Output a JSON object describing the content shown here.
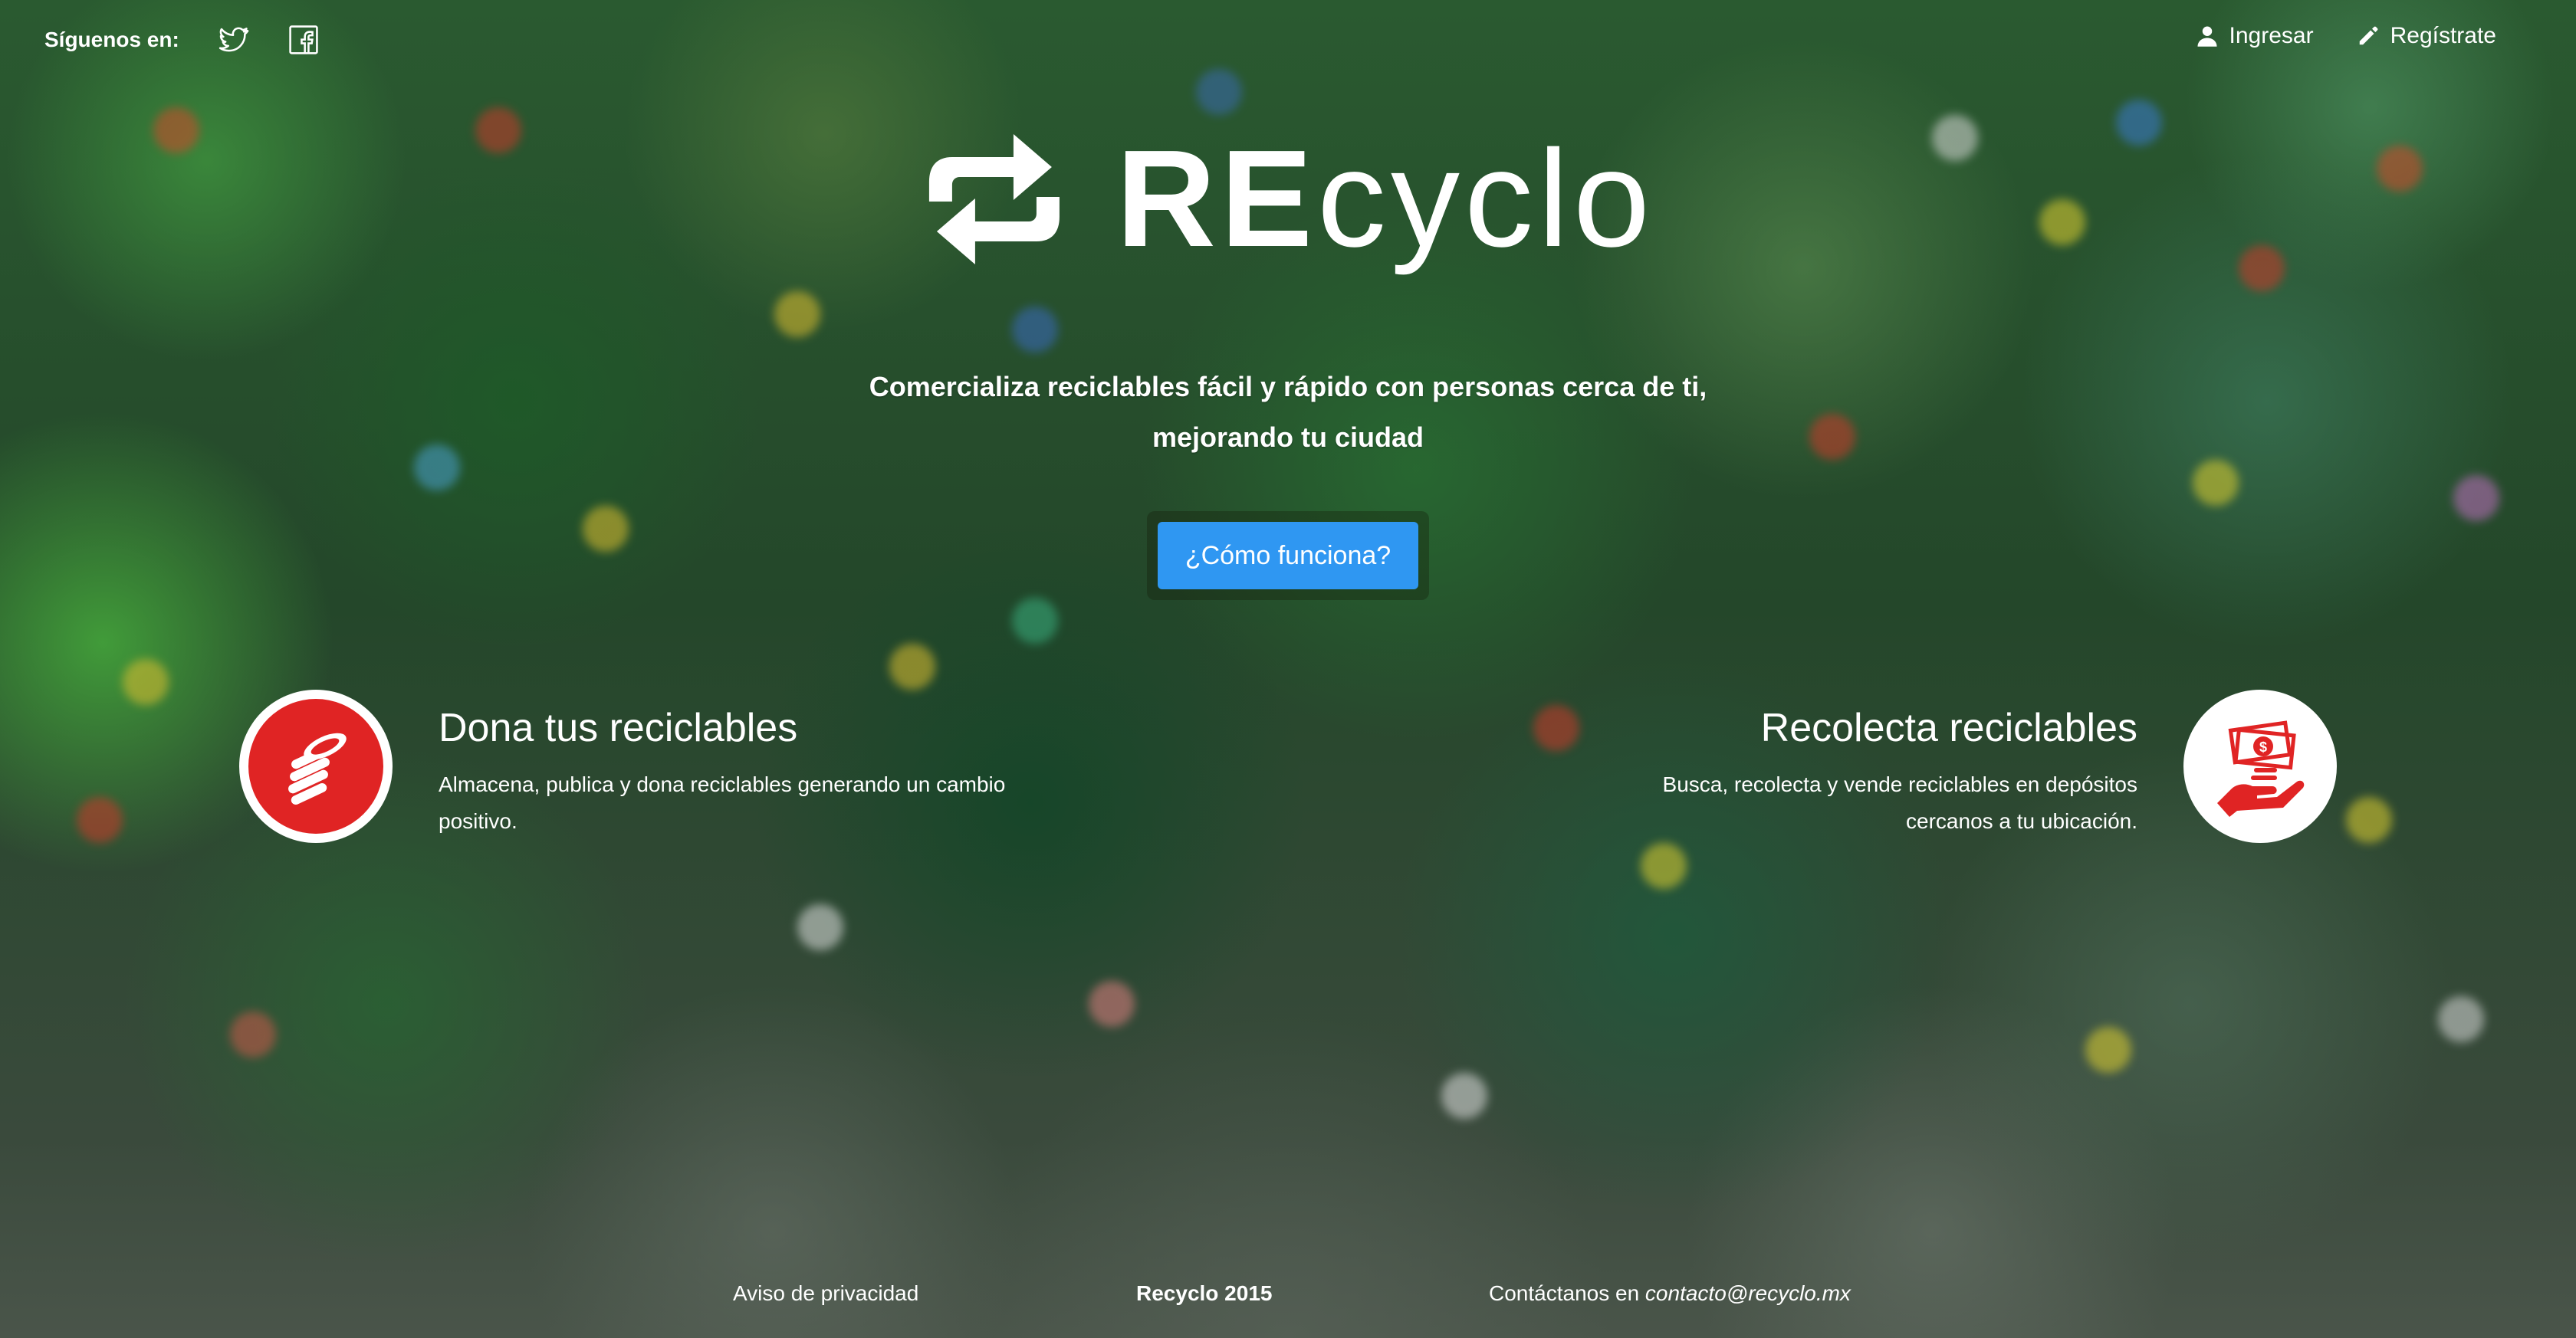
{
  "topbar": {
    "follow_label": "Síguenos en:",
    "social": [
      {
        "icon": "twitter-icon"
      },
      {
        "icon": "facebook-icon"
      }
    ],
    "login_label": "Ingresar",
    "register_label": "Regístrate"
  },
  "logo": {
    "bold": "RE",
    "thin": "cyclo"
  },
  "hero": {
    "tagline": "Comercializa reciclables fácil y rápido con personas cerca de ti, mejorando tu ciudad",
    "cta_label": "¿Cómo funciona?"
  },
  "features": {
    "donate": {
      "title": "Dona tus reciclables",
      "description": "Almacena, publica y dona reciclables generando un cambio positivo.",
      "icon": "coins-icon"
    },
    "collect": {
      "title": "Recolecta reciclables",
      "description": "Busca, recolecta y vende reciclables en depósitos cercanos a tu ubicación.",
      "icon": "money-hand-icon"
    }
  },
  "footer": {
    "privacy": "Aviso de privacidad",
    "copyright": "Recyclo 2015",
    "contact_prefix": "Contáctanos en ",
    "contact_email": "contacto@recyclo.mx"
  },
  "colors": {
    "accent_blue": "#2f97f2",
    "brand_red": "#e02424",
    "text": "#ffffff"
  }
}
